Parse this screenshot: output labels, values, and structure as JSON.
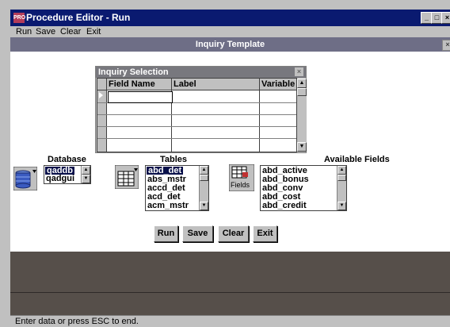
{
  "window": {
    "title": "Procedure Editor - Run",
    "app_icon_text": "PRO",
    "min_glyph": "_",
    "max_glyph": "□",
    "close_glyph": "×"
  },
  "menu": {
    "items": [
      "Run",
      "Save",
      "Clear",
      "Exit"
    ]
  },
  "template": {
    "title": "Inquiry Template"
  },
  "inquiry": {
    "title": "Inquiry Selection",
    "columns": [
      "Field Name",
      "Label",
      "Variable"
    ]
  },
  "database": {
    "label": "Database",
    "items": [
      "qaddb",
      "qadgui"
    ],
    "selected": "qaddb"
  },
  "tables": {
    "label": "Tables",
    "items": [
      "abd_det",
      "abs_mstr",
      "accd_det",
      "acd_det",
      "acm_mstr"
    ],
    "selected": "abd_det"
  },
  "fields_icon_label": "Fields",
  "available_fields": {
    "label": "Available Fields",
    "items": [
      "abd_active",
      "abd_bonus",
      "abd_conv",
      "abd_cost",
      "abd_credit"
    ]
  },
  "buttons": {
    "run": "Run",
    "save": "Save",
    "clear": "Clear",
    "exit": "Exit"
  },
  "status": {
    "text": "Enter data or press ESC to end."
  },
  "colors": {
    "titlebar": "#0a1a70",
    "subtitle": "#6e6e86",
    "band": "#564f4a",
    "selection": "#08104a"
  }
}
